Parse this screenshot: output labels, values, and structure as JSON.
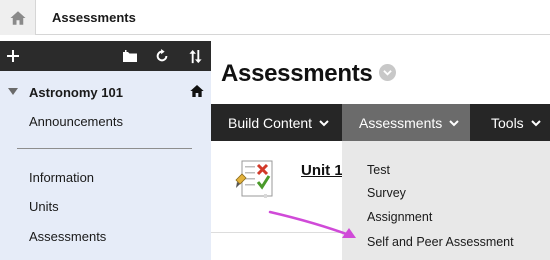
{
  "breadcrumb": {
    "current": "Assessments"
  },
  "course_menu": {
    "course_title": "Astronomy 101",
    "items": [
      {
        "label": "Announcements"
      },
      {
        "label": "Information"
      },
      {
        "label": "Units"
      },
      {
        "label": "Assessments"
      }
    ]
  },
  "main": {
    "page_title": "Assessments",
    "content_item_title": "Unit 1"
  },
  "menubar": {
    "tabs": [
      {
        "label": "Build Content"
      },
      {
        "label": "Assessments"
      },
      {
        "label": "Tools"
      }
    ],
    "active_tab": "Assessments"
  },
  "assessments_dropdown": {
    "items": [
      {
        "label": "Test"
      },
      {
        "label": "Survey"
      },
      {
        "label": "Assignment"
      },
      {
        "label": "Self and Peer Assessment"
      }
    ]
  },
  "colors": {
    "menubar": "#262626",
    "active_tab": "#6b6b6b",
    "left_panel": "#e6ecf8",
    "dropdown": "#e8e8e8",
    "annotation_arrow": "#d04ad8"
  }
}
